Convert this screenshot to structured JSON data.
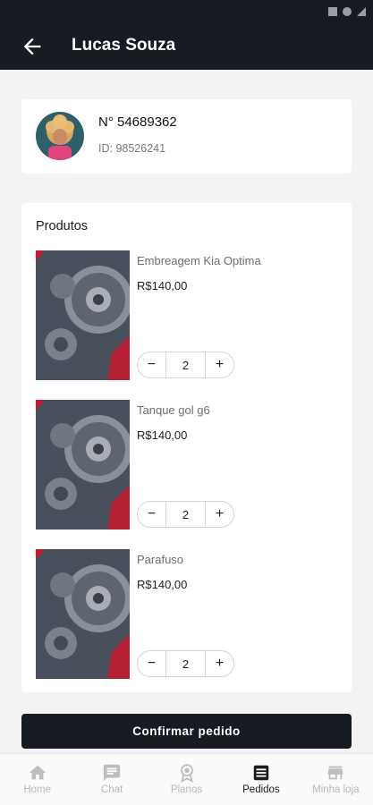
{
  "header": {
    "title": "Lucas Souza"
  },
  "order": {
    "number": "N° 54689362",
    "id": "ID: 98526241"
  },
  "products": {
    "title": "Produtos",
    "items": [
      {
        "name": "Embreagem Kia Optima",
        "price": "R$140,00",
        "quantity": "2"
      },
      {
        "name": "Tanque gol g6",
        "price": "R$140,00",
        "quantity": "2"
      },
      {
        "name": "Parafuso",
        "price": "R$140,00",
        "quantity": "2"
      }
    ]
  },
  "confirm_label": "Confirmar pedido",
  "nav": {
    "items": [
      {
        "label": "Home",
        "icon": "home-icon"
      },
      {
        "label": "Chat",
        "icon": "chat-icon"
      },
      {
        "label": "Planos",
        "icon": "badge-icon"
      },
      {
        "label": "Pedidos",
        "icon": "list-icon",
        "active": true
      },
      {
        "label": "Minha loja",
        "icon": "store-icon"
      }
    ]
  },
  "colors": {
    "dark": "#161a21",
    "accent": "#c8182d"
  }
}
